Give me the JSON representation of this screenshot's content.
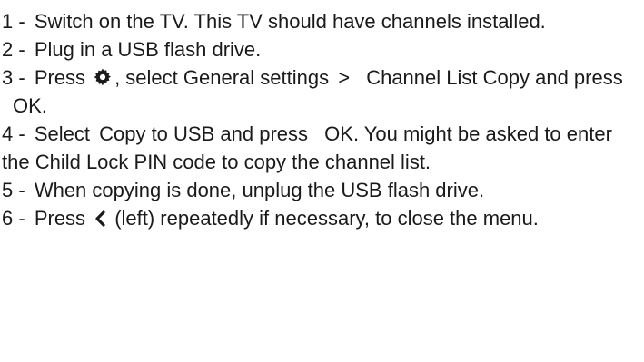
{
  "steps": [
    {
      "number": "1 -",
      "text": "Switch on the TV. This TV should have channels installed."
    },
    {
      "number": "2 -",
      "text": "Plug in a USB flash drive."
    },
    {
      "number": "3 -",
      "prefix": "Press",
      "icon": "settings-gear-icon",
      "middle": ", select",
      "menu_path_1": "General settings",
      "separator": ">",
      "menu_path_2": "Channel List Copy",
      "connector": "and press",
      "key": "OK",
      "suffix": "."
    },
    {
      "number": "4 -",
      "prefix": "Select",
      "option": "Copy to USB",
      "connector": "and press",
      "key": "OK",
      "suffix": ". You might be asked to enter the Child Lock PIN code to copy the channel list."
    },
    {
      "number": "5 -",
      "text": "When copying is done, unplug the USB flash drive."
    },
    {
      "number": "6 -",
      "prefix": "Press",
      "icon": "chevron-left-icon",
      "suffix": "(left) repeatedly if necessary, to close the menu."
    }
  ]
}
